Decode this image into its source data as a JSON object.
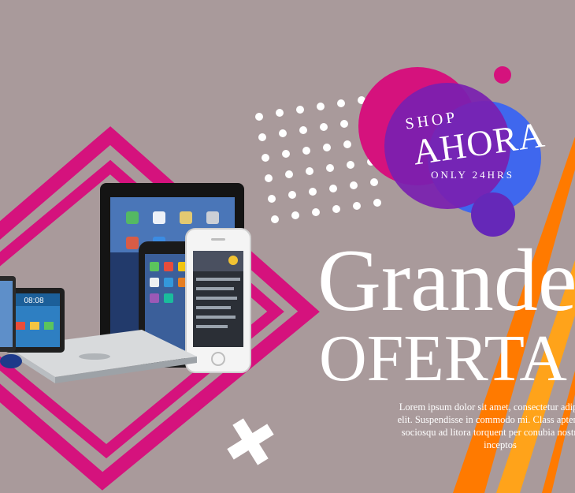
{
  "colors": {
    "background": "#a99a9b",
    "magenta": "#d5127d",
    "purple": "#7a1fb0",
    "blue": "#3f67ee",
    "orange": "#ff7a00",
    "orange_light": "#ffa31a",
    "white": "#ffffff"
  },
  "badge": {
    "shop": "SHOP",
    "ahora": "AHORA",
    "only": "ONLY 24HRS"
  },
  "headline": {
    "line1": "Grande",
    "line2": "OFERTA"
  },
  "body_text": {
    "line1": "Lorem ipsum dolor sit amet, consectetur adipiscing",
    "line2": "elit. Suspendisse in commodo mi. Class aptent taciti",
    "line3": "sociosqu ad litora torquent per conubia nostra, per",
    "line4": "inceptos"
  },
  "product_screen": {
    "tablet_time": "08:08"
  },
  "icons": [
    "dot-grid-icon",
    "cross-icon",
    "diamond-frame-icon",
    "devices-illustration-icon"
  ]
}
